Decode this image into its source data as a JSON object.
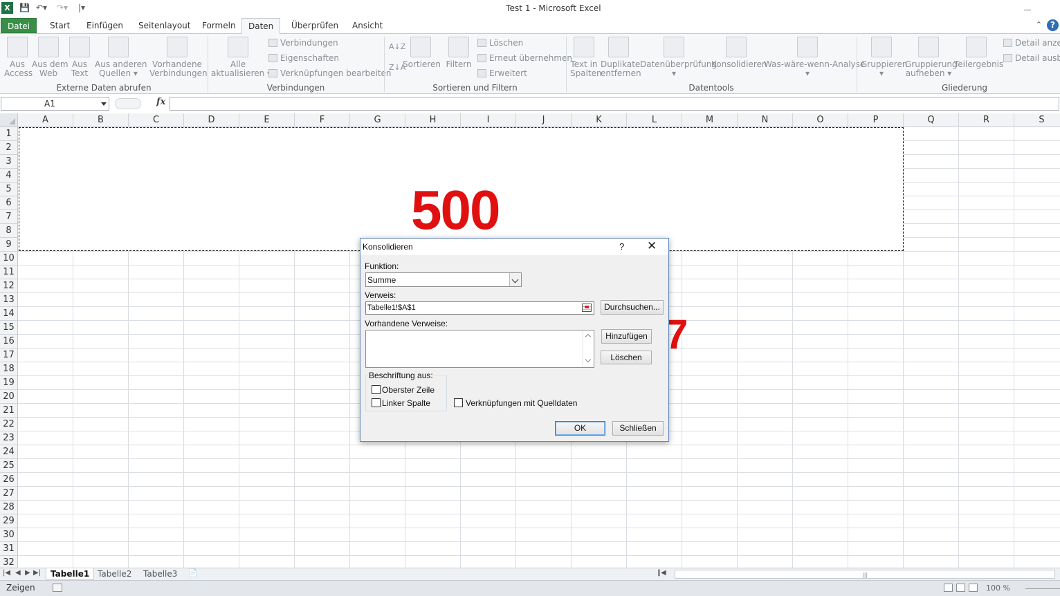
{
  "window": {
    "title": "Test 1  -  Microsoft Excel",
    "app_icon": "excel-icon"
  },
  "ribbon_tabs": [
    "Datei",
    "Start",
    "Einfügen",
    "Seitenlayout",
    "Formeln",
    "Daten",
    "Überprüfen",
    "Ansicht"
  ],
  "active_tab": "Daten",
  "ribbon": {
    "externe_daten": {
      "label": "Externe Daten abrufen",
      "buttons": [
        {
          "l1": "Aus",
          "l2": "Access"
        },
        {
          "l1": "Aus dem",
          "l2": "Web"
        },
        {
          "l1": "Aus",
          "l2": "Text"
        },
        {
          "l1": "Aus anderen",
          "l2": "Quellen ▾"
        },
        {
          "l1": "Vorhandene",
          "l2": "Verbindungen"
        }
      ]
    },
    "verbindungen": {
      "label": "Verbindungen",
      "alle": {
        "l1": "Alle",
        "l2": "aktualisieren ▾"
      },
      "small": [
        "Verbindungen",
        "Eigenschaften",
        "Verknüpfungen bearbeiten"
      ]
    },
    "sortieren": {
      "label": "Sortieren und Filtern",
      "az": "A↓Z",
      "za": "Z↓A",
      "sortieren": "Sortieren",
      "filtern": "Filtern",
      "small": [
        "Löschen",
        "Erneut übernehmen",
        "Erweitert"
      ]
    },
    "datentools": {
      "label": "Datentools",
      "buttons": [
        {
          "l1": "Text in",
          "l2": "Spalten"
        },
        {
          "l1": "Duplikate",
          "l2": "entfernen"
        },
        {
          "l1": "Datenüberprüfung",
          "l2": "▾"
        },
        {
          "l1": "Konsolidieren",
          "l2": ""
        },
        {
          "l1": "Was-wäre-wenn-Analyse",
          "l2": "▾"
        }
      ]
    },
    "gliederung": {
      "label": "Gliederung",
      "buttons": [
        {
          "l1": "Gruppieren",
          "l2": "▾"
        },
        {
          "l1": "Gruppierung",
          "l2": "aufheben ▾"
        },
        {
          "l1": "Teilergebnis",
          "l2": ""
        }
      ],
      "small": [
        "Detail anzeig",
        "Detail ausble"
      ]
    }
  },
  "formula_bar": {
    "name_box": "A1",
    "fx": "fx",
    "formula": ""
  },
  "columns": [
    "A",
    "B",
    "C",
    "D",
    "E",
    "F",
    "G",
    "H",
    "I",
    "J",
    "K",
    "L",
    "M",
    "N",
    "O",
    "P",
    "Q",
    "R",
    "S"
  ],
  "rows": [
    "1",
    "2",
    "3",
    "4",
    "5",
    "6",
    "7",
    "8",
    "9",
    "10",
    "11",
    "12",
    "13",
    "14",
    "15",
    "16",
    "17",
    "18",
    "19",
    "20",
    "21",
    "22",
    "23",
    "24",
    "25",
    "26",
    "27",
    "28",
    "29",
    "30",
    "31",
    "32"
  ],
  "overlays": {
    "big_number": "500",
    "side_number": "7"
  },
  "sheet_tabs": [
    "Tabelle1",
    "Tabelle2",
    "Tabelle3"
  ],
  "active_sheet": "Tabelle1",
  "status": {
    "mode": "Zeigen",
    "zoom": "100 %"
  },
  "dialog": {
    "title": "Konsolidieren",
    "help": "?",
    "close": "✕",
    "funktion_label": "Funktion:",
    "funktion_value": "Summe",
    "verweis_label": "Verweis:",
    "verweis_value": "Tabelle1!$A$1",
    "durchsuchen": "Durchsuchen...",
    "vorhandene_label": "Vorhandene Verweise:",
    "hinzufuegen": "Hinzufügen",
    "loeschen": "Löschen",
    "beschriftung_label": "Beschriftung aus:",
    "oberster_zeile": "Oberster Zeile",
    "linker_spalte": "Linker Spalte",
    "verknuepfungen": "Verknüpfungen mit Quelldaten",
    "ok": "OK",
    "schliessen": "Schließen"
  },
  "colors": {
    "excel_green": "#1f7244",
    "file_tab": "#3a8f47",
    "annotation_red": "#e01010"
  }
}
